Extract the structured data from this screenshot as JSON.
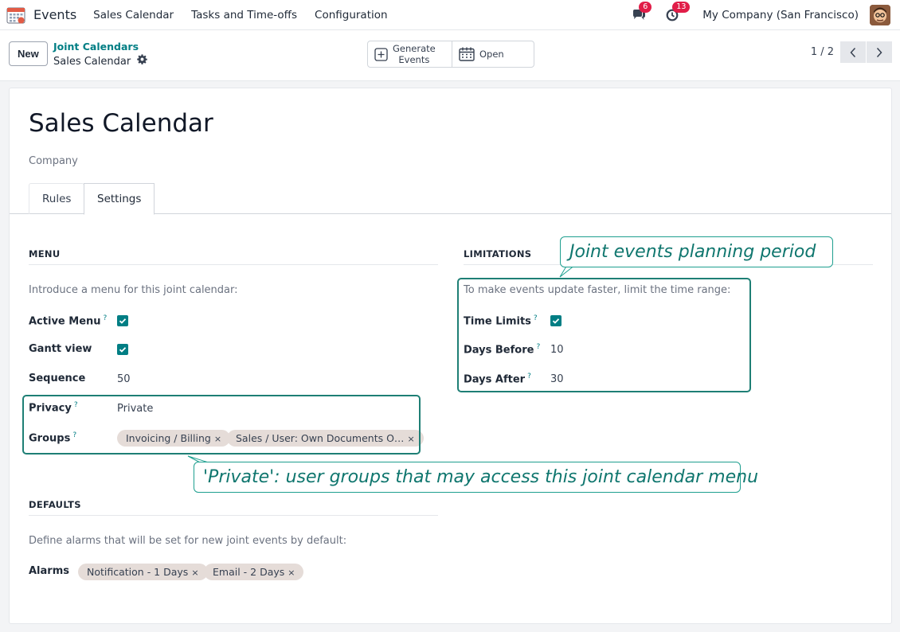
{
  "navbar": {
    "app_name": "Events",
    "menu": [
      "Sales Calendar",
      "Tasks and Time-offs",
      "Configuration"
    ],
    "messages_count": "6",
    "activities_count": "13",
    "company": "My Company (San Francisco)"
  },
  "control_panel": {
    "new_label": "New",
    "breadcrumb_parent": "Joint Calendars",
    "breadcrumb_current": "Sales Calendar",
    "actions": {
      "generate_events": "Generate\nEvents",
      "open": "Open"
    },
    "pager": "1 / 2"
  },
  "form": {
    "title": "Sales Calendar",
    "company_placeholder": "Company",
    "tabs": [
      "Rules",
      "Settings"
    ],
    "menu_section": {
      "title": "MENU",
      "help": "Introduce a menu for this joint calendar:",
      "active_menu_label": "Active Menu",
      "gantt_view_label": "Gantt view",
      "sequence_label": "Sequence",
      "sequence_value": "50",
      "privacy_label": "Privacy",
      "privacy_value": "Private",
      "groups_label": "Groups",
      "groups": [
        "Invoicing / Billing",
        "Sales / User: Own Documents O…"
      ]
    },
    "limitations_section": {
      "title": "LIMITATIONS",
      "help": "To make events update faster, limit the time range:",
      "time_limits_label": "Time Limits",
      "days_before_label": "Days Before",
      "days_before_value": "10",
      "days_after_label": "Days After",
      "days_after_value": "30"
    },
    "defaults_section": {
      "title": "DEFAULTS",
      "help": "Define alarms that will be set for new joint events by default:",
      "alarms_label": "Alarms",
      "alarms": [
        "Notification - 1 Days",
        "Email - 2 Days"
      ]
    },
    "help_marker": "?",
    "tag_remove": "×"
  },
  "annotations": {
    "limitations_callout": "Joint events planning period",
    "privacy_callout": "'Private': user groups that may access this joint calendar menu"
  },
  "colors": {
    "accent": "#017e84",
    "annotation": "#1e7f75",
    "badge": "#e11d48",
    "tag_bg": "#e5dcd8"
  }
}
